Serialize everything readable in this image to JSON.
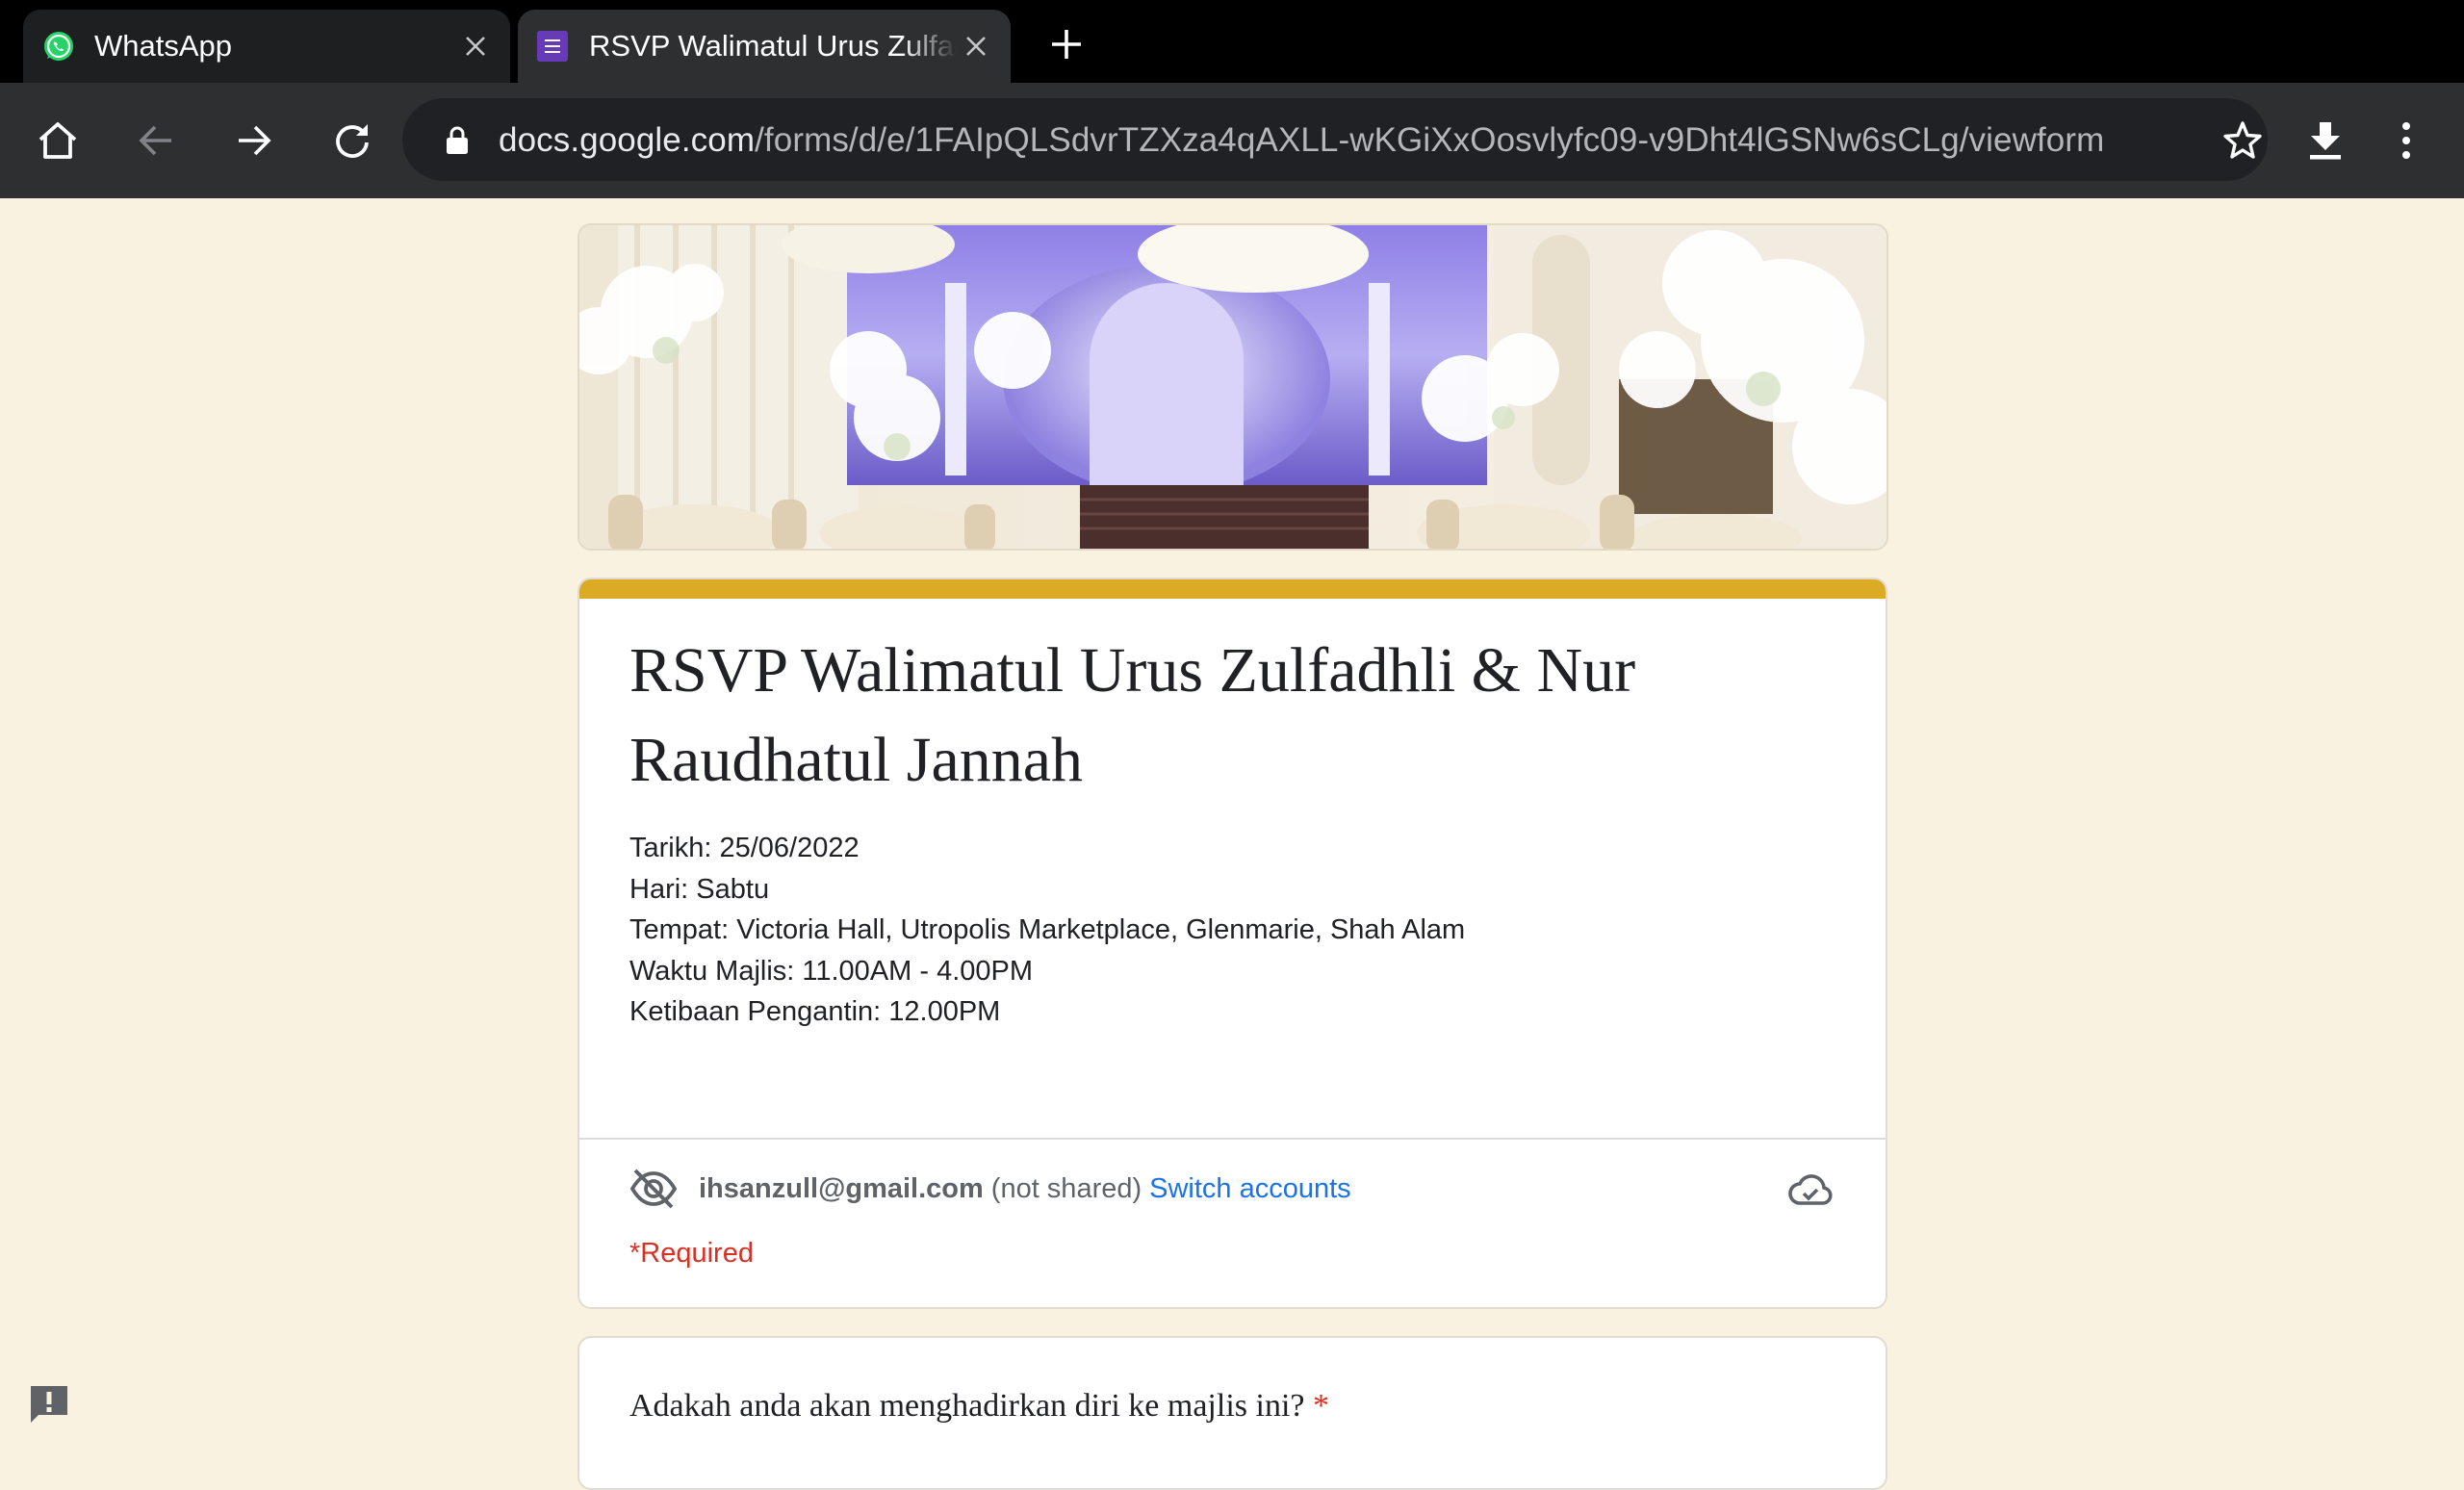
{
  "tabs": [
    {
      "title": "WhatsApp",
      "icon": "whatsapp-icon",
      "active": false
    },
    {
      "title": "RSVP Walimatul Urus Zulfadhli & Nur Raudhatul Jannah",
      "icon": "google-forms-icon",
      "active": true
    }
  ],
  "toolbar": {
    "url_domain": "docs.google.com",
    "url_path": "/forms/d/e/1FAIpQLSdvrTZXza4qAXLL-wKGiXxOosvlyfc09-v9Dht4lGSNw6sCLg/viewform"
  },
  "form": {
    "accent_color": "#dcab26",
    "title": "RSVP Walimatul Urus Zulfadhli & Nur Raudhatul Jannah",
    "description": [
      "Tarikh: 25/06/2022",
      "Hari: Sabtu",
      "Tempat: Victoria Hall, Utropolis Marketplace, Glenmarie, Shah Alam",
      "Waktu Majlis: 11.00AM - 4.00PM",
      "Ketibaan Pengantin: 12.00PM"
    ],
    "account": {
      "email": "ihsanzull@gmail.com",
      "not_shared": "(not shared)",
      "switch_label": "Switch accounts"
    },
    "required_note": "*Required",
    "questions": [
      {
        "text": "Adakah anda akan menghadirkan diri ke majlis ini?",
        "required_mark": "*"
      }
    ]
  },
  "colors": {
    "page_bg": "#faf2e1",
    "link": "#1a73e8",
    "required": "#d93025"
  }
}
